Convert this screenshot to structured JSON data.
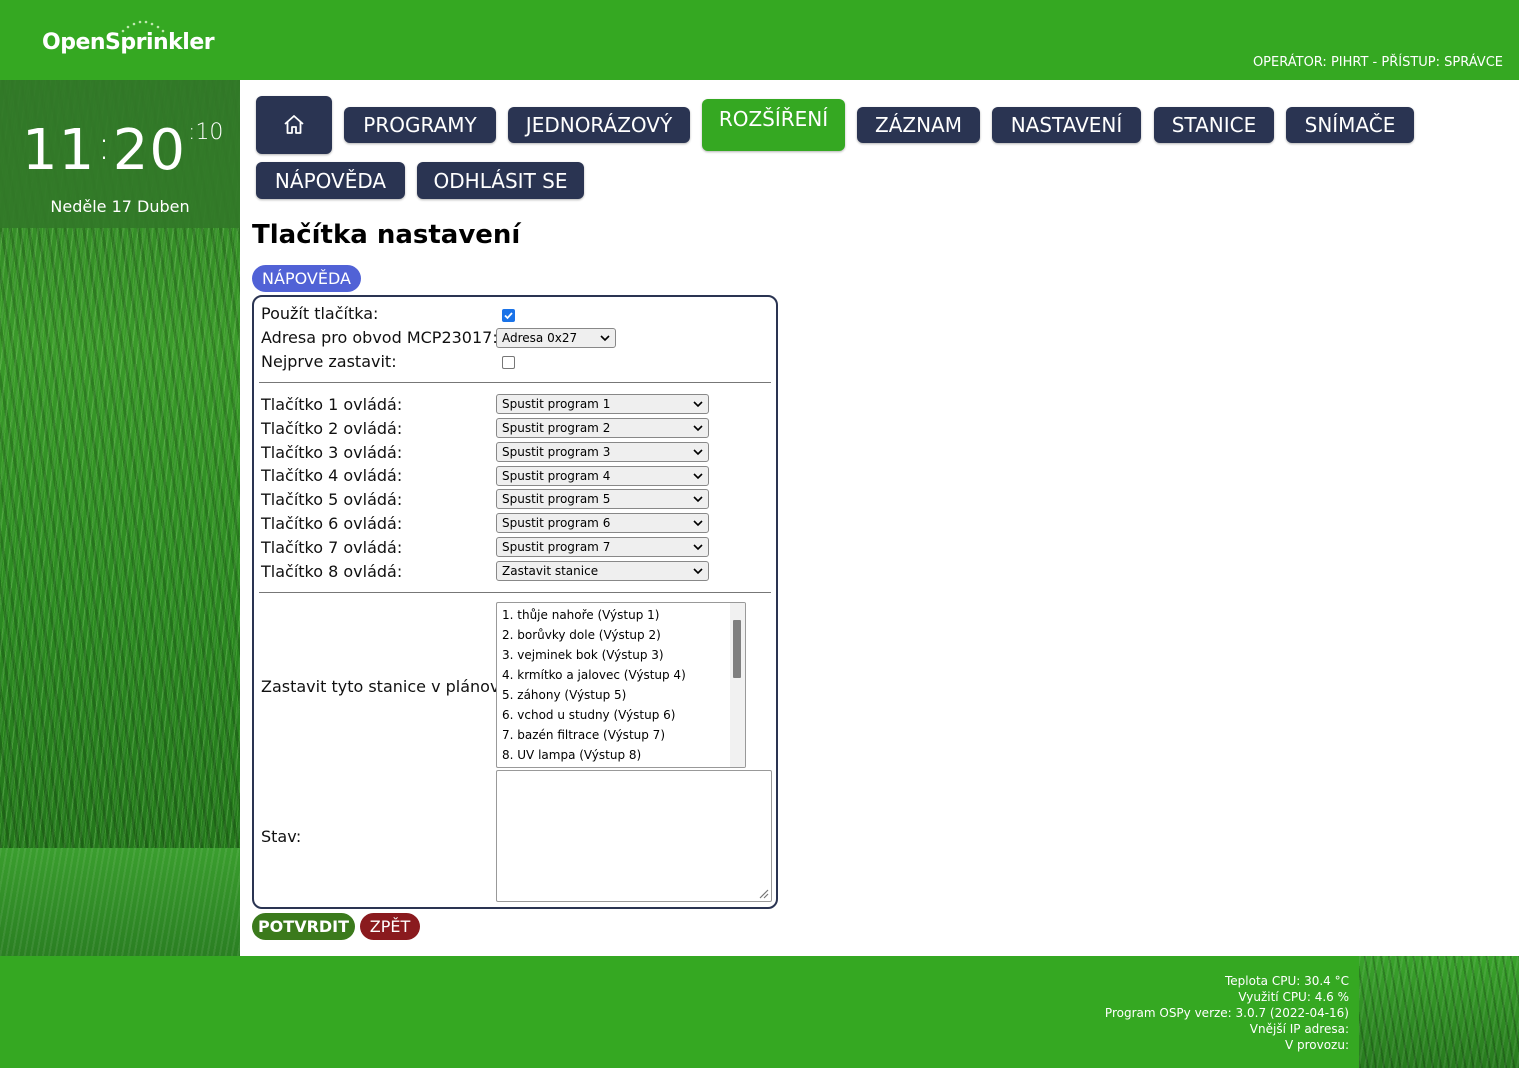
{
  "header": {
    "logo": "OpenSprinkler",
    "operator": "OPERÁTOR: PIHRT - PŘÍSTUP: SPRÁVCE",
    "brand_color": "#35a822"
  },
  "clock": {
    "hours": "11",
    "minutes": "20",
    "seconds": "10",
    "date": "Neděle 17 Duben"
  },
  "nav": {
    "home_icon": "home-icon",
    "items": [
      {
        "label": "PROGRAMY"
      },
      {
        "label": "JEDNORÁZOVÝ"
      },
      {
        "label": "ROZŠÍŘENÍ",
        "active": true
      },
      {
        "label": "ZÁZNAM"
      },
      {
        "label": "NASTAVENÍ"
      },
      {
        "label": "STANICE"
      },
      {
        "label": "SNÍMAČE"
      },
      {
        "label": "NÁPOVĚDA"
      },
      {
        "label": "ODHLÁSIT SE"
      }
    ]
  },
  "page": {
    "title": "Tlačítka nastavení",
    "help_button": "NÁPOVĚDA"
  },
  "form": {
    "use_buttons_label": "Použít tlačítka:",
    "use_buttons_checked": true,
    "address_label": "Adresa pro obvod MCP23017:",
    "address_value": "Adresa 0x27",
    "stop_first_label": "Nejprve zastavit:",
    "stop_first_checked": false,
    "buttons": [
      {
        "label": "Tlačítko 1 ovládá:",
        "value": "Spustit program 1"
      },
      {
        "label": "Tlačítko 2 ovládá:",
        "value": "Spustit program 2"
      },
      {
        "label": "Tlačítko 3 ovládá:",
        "value": "Spustit program 3"
      },
      {
        "label": "Tlačítko 4 ovládá:",
        "value": "Spustit program 4"
      },
      {
        "label": "Tlačítko 5 ovládá:",
        "value": "Spustit program 5"
      },
      {
        "label": "Tlačítko 6 ovládá:",
        "value": "Spustit program 6"
      },
      {
        "label": "Tlačítko 7 ovládá:",
        "value": "Spustit program 7"
      },
      {
        "label": "Tlačítko 8 ovládá:",
        "value": "Zastavit stanice"
      }
    ],
    "stop_stations_label": "Zastavit tyto stanice v plánovači",
    "stations": [
      "1. thůje nahoře (Výstup 1)",
      "2. borůvky dole (Výstup 2)",
      "3. vejminek bok (Výstup 3)",
      "4. krmítko a jalovec (Výstup 4)",
      "5. záhony (Výstup 5)",
      "6. vchod u studny (Výstup 6)",
      "7. bazén filtrace (Výstup 7)",
      "8. UV lampa (Výstup 8)"
    ],
    "status_label": "Stav:",
    "status_value": "",
    "confirm_button": "POTVRDIT",
    "back_button": "ZPĚT"
  },
  "footer": {
    "cpu_temp": "Teplota CPU: 30.4 °C",
    "cpu_usage": "Využití CPU: 4.6 %",
    "version": "Program OSPy verze: 3.0.7 (2022-04-16)",
    "external_ip": "Vnější IP adresa:",
    "uptime": "V provozu:"
  }
}
